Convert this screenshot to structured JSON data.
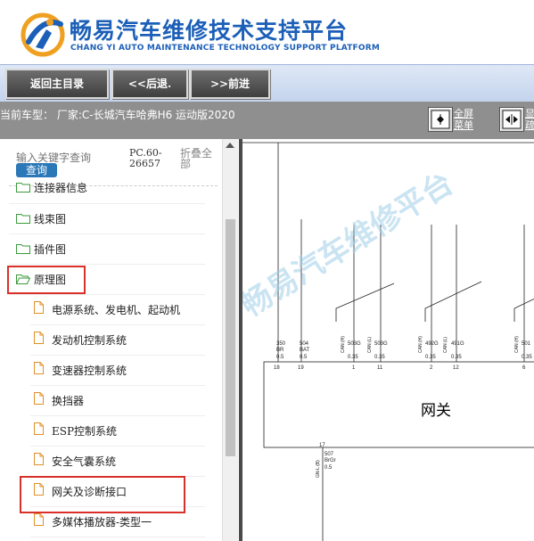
{
  "header": {
    "brand_cn": "畅易汽车维修技术支持平台",
    "brand_en": "CHANG YI AUTO MAINTENANCE TECHNOLOGY SUPPORT PLATFORM",
    "brand_color": "#1c5fb8",
    "logo_icon": "cy-logo-icon"
  },
  "nav": {
    "home": "返回主目录",
    "back": "<<后退.",
    "forward": ">>前进"
  },
  "vehicle_bar": {
    "text": "当前车型： 厂家:C-长城汽车哈弗H6 运动版2020",
    "fullscreen_label_1": "全屏",
    "fullscreen_label_2": "菜单",
    "extra_label_1": "显",
    "extra_label_2": "疏"
  },
  "search": {
    "placeholder": "输入关键字查询",
    "button": "查询",
    "code": "PC.60-26657",
    "fold": "折叠全部"
  },
  "tree": {
    "items": [
      {
        "label": "连接器信息",
        "type": "folder"
      },
      {
        "label": "线束图",
        "type": "folder"
      },
      {
        "label": "插件图",
        "type": "folder"
      },
      {
        "label": "原理图",
        "type": "folder-open"
      },
      {
        "label": "电源系统、发电机、起动机",
        "type": "file"
      },
      {
        "label": "发动机控制系统",
        "type": "file"
      },
      {
        "label": "变速器控制系统",
        "type": "file"
      },
      {
        "label": "换挡器",
        "type": "file"
      },
      {
        "label": "ESP控制系统",
        "type": "file"
      },
      {
        "label": "安全气囊系统",
        "type": "file"
      },
      {
        "label": "网关及诊断接口",
        "type": "file"
      },
      {
        "label": "多媒体播放器-类型一",
        "type": "file"
      }
    ]
  },
  "diagram": {
    "watermark": "畅易汽车维修平台",
    "gateway_label": "网关",
    "wires_top": [
      {
        "code": "350",
        "color": "BR",
        "size": "0.5",
        "pin": "18"
      },
      {
        "code": "504",
        "color": "BAT",
        "size": "0.5",
        "pin": "19"
      },
      {
        "code": "503G",
        "color": "CAN (H)",
        "size": "0.35",
        "pin": "1"
      },
      {
        "code": "503G",
        "color": "CAN (L)",
        "size": "0.35",
        "pin": "11"
      },
      {
        "code": "492G",
        "color": "CAN (H)",
        "size": "0.35",
        "pin": "2"
      },
      {
        "code": "491G",
        "color": "CAN (L)",
        "size": "0.35",
        "pin": "12"
      },
      {
        "code": "501",
        "color": "CAN (H)",
        "size": "0.35",
        "pin": "6"
      }
    ],
    "wire_bottom": {
      "pin": "17",
      "code": "507",
      "color": "BrGr",
      "size": "0.5",
      "signal": "GN-L (B)"
    }
  }
}
